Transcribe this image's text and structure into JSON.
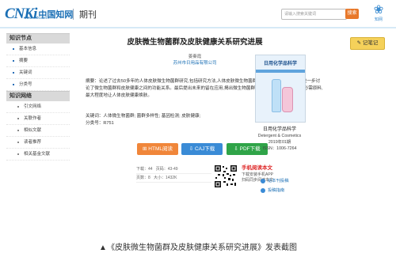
{
  "header": {
    "logo_main": "CNKi",
    "logo_cn": "中国知网",
    "logo_url": "www.cnki.net",
    "section_title": "期刊",
    "search_placeholder": "请输入搜索关键词",
    "search_button": "搜索",
    "brand_text": "知网"
  },
  "sidebar": {
    "sections": [
      {
        "title": "知识节点",
        "items": [
          "基本信息",
          "摘要",
          "关键词",
          "分类号"
        ]
      },
      {
        "title": "知识网络",
        "items": [
          "引文网络",
          "关联作者",
          "相似文献",
          "读者推荐",
          "相关基金文献"
        ]
      }
    ]
  },
  "article": {
    "title": "皮肤微生物菌群及皮肤健康关系研究进展",
    "author": "姜秦霞",
    "organization": "苏州市日用品有限公司",
    "favorite_button": "记笔记",
    "abstract_label": "摘要：",
    "abstract_text": "论述了过去50多年的人体皮肤微生物菌群研究,包括研究方法,人体皮肤微生物菌群特征,关键影响因素等。进一步讨论了微生物菌群和皮肤健康之间的功能关系。最后提出未来的留在应用,揭出微生物菌群可能成为未来日化产品的必需原料,最大程度地让人体皮肤健康焕肤。",
    "keywords_label": "关键词：",
    "keywords": "人体微生物菌群; 菌群多样性; 基因检测; 皮肤健康;",
    "clc_label": "分类号：",
    "clc": "R751"
  },
  "downloads": {
    "html": "HTML阅读",
    "caj": "CAJ下载",
    "pdf": "PDF下载"
  },
  "stats": {
    "pages_label": "下载：44",
    "pages_value": "页码：43-49",
    "size_label": "页数：8",
    "size_value": "大小：1432K"
  },
  "mobile": {
    "title": "手机阅读本文",
    "line1": "下载安装手机APP",
    "line2": "扫码同步阅读本文"
  },
  "journal": {
    "cover_title": "日用化学品科学",
    "name_cn": "日用化学品科学",
    "name_en": "Detergent & Cosmetics",
    "issue": "2019年01期",
    "issn": "ISSN：1006-7264",
    "link1": "给本刊投稿",
    "link2": "投稿指南"
  },
  "caption": "▲《皮肤微生物菌群及皮肤健康关系研究进展》发表截图"
}
